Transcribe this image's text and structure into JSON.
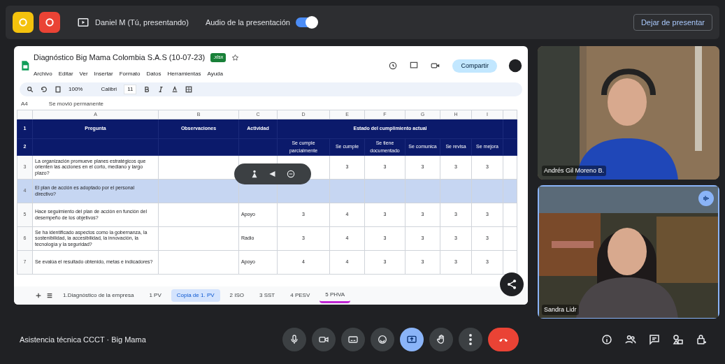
{
  "top_bar": {
    "app_icons": [
      {
        "color": "#f4c20d"
      },
      {
        "color": "#ea4335"
      }
    ],
    "presenter": "Daniel M (Tú, presentando)",
    "audio_label": "Audio de la presentación",
    "audio_on": true,
    "stop_button": "Dejar de presentar"
  },
  "sheet": {
    "title": "Diagnóstico Big Mama Colombia S.A.S (10-07-23)",
    "badge": ".xlsx",
    "menu": [
      "Archivo",
      "Editar",
      "Ver",
      "Insertar",
      "Formato",
      "Datos",
      "Herramientas",
      "Ayuda"
    ],
    "share_button": "Compartir",
    "toolbar": {
      "zoom": "100%",
      "font": "Calibri",
      "size": "11"
    },
    "cell_ref": "A4",
    "formula": "Se movió permanente",
    "columns": [
      "A",
      "B",
      "C",
      "D",
      "E",
      "F",
      "G",
      "H",
      "I"
    ],
    "header_row_numbers": [
      "1",
      "2"
    ],
    "headers": [
      "Pregunta",
      "Observaciones",
      "Actividad",
      "Estado del cumplimiento actual"
    ],
    "subheaders": [
      "Se cumple parcialmente",
      "Se cumple",
      "Se tiene documentado",
      "Se comunica",
      "Se revisa",
      "Se mejora"
    ],
    "rows": [
      {
        "number": "3",
        "question": "La organización promueve planes estratégicos que orienten las acciones en el corto, mediano y largo plazo?",
        "activity": "",
        "cells": {
          "E": "3",
          "F": "3",
          "G": "3",
          "H": "3",
          "I": "3"
        },
        "selected": false
      },
      {
        "number": "4",
        "question": "El plan de acción es adoptado por el personal directivo?",
        "activity": "",
        "selected": true
      },
      {
        "number": "5",
        "question": "Hace seguimiento del plan de acción en función del desempeño de los objetivos?",
        "activity": "Apoyo",
        "cells": {
          "D": "3",
          "E": "4",
          "F": "3",
          "G": "3",
          "H": "3",
          "I": "3"
        },
        "selected": false
      },
      {
        "number": "6",
        "question": "Se ha identificado aspectos como la gobernanza, la sostenibilidad, la accesibilidad, la innovación, la tecnología y la seguridad?",
        "activity": "Radio",
        "cells": {
          "D": "3",
          "E": "4",
          "F": "3",
          "G": "3",
          "H": "3",
          "I": "3"
        },
        "selected": false
      },
      {
        "number": "7",
        "question": "Se evalúa el resultado obtenido, metas e indicadores?",
        "activity": "Apoyo",
        "cells": {
          "D": "4",
          "E": "4",
          "F": "3",
          "G": "3",
          "H": "3",
          "I": "3"
        },
        "selected": false
      }
    ],
    "tabs": [
      {
        "label": "1.Diagnóstico de la empresa",
        "selected": false
      },
      {
        "label": "1 PV",
        "selected": false
      },
      {
        "label": "Copia de 1. PV",
        "selected": true
      },
      {
        "label": "2 ISO",
        "selected": false
      },
      {
        "label": "3 SST",
        "selected": false
      },
      {
        "label": "4 PESV",
        "selected": false
      },
      {
        "label": "5 PHVA",
        "selected": false,
        "color": "#c026d3"
      }
    ]
  },
  "participants": [
    {
      "name": "Andrés Gil Moreno B.",
      "kind": "man",
      "speaking": false
    },
    {
      "name": "Sandra Lidr",
      "kind": "woman",
      "speaking": true
    }
  ],
  "meeting_name": "Asistencia técnica CCCT · Big Mama",
  "controls": [
    {
      "kind": "mic",
      "selected": false
    },
    {
      "kind": "camera",
      "selected": false
    },
    {
      "kind": "captions",
      "selected": false
    },
    {
      "kind": "emoji",
      "selected": false
    },
    {
      "kind": "present",
      "selected": true
    },
    {
      "kind": "hand",
      "selected": false
    },
    {
      "kind": "more",
      "selected": false
    },
    {
      "kind": "hangup"
    }
  ],
  "side_controls": [
    {
      "kind": "info"
    },
    {
      "kind": "people"
    },
    {
      "kind": "chat"
    },
    {
      "kind": "shapes"
    },
    {
      "kind": "lock"
    }
  ]
}
